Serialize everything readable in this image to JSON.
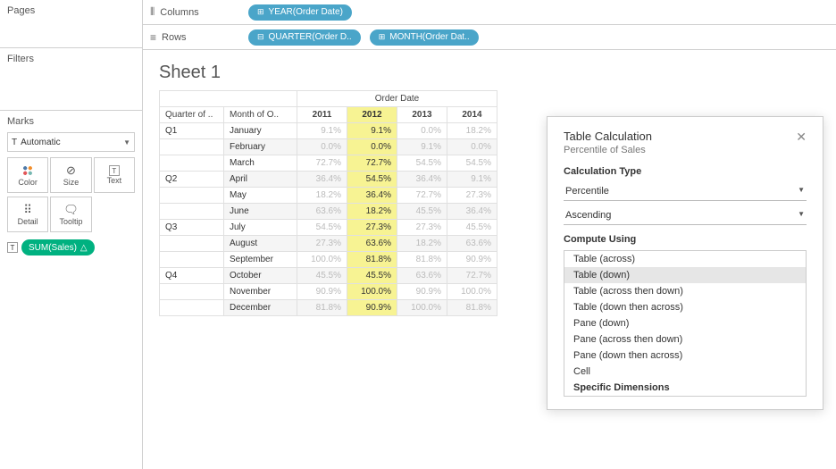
{
  "sidebar": {
    "pages_label": "Pages",
    "filters_label": "Filters",
    "marks_label": "Marks",
    "marks_type": "Automatic",
    "cards": {
      "color": "Color",
      "size": "Size",
      "text": "Text",
      "detail": "Detail",
      "tooltip": "Tooltip"
    },
    "measure_pill": "SUM(Sales)"
  },
  "shelves": {
    "columns_label": "Columns",
    "rows_label": "Rows",
    "columns_pills": [
      "YEAR(Order Date)"
    ],
    "rows_pills": [
      "QUARTER(Order D..",
      "MONTH(Order Dat.."
    ]
  },
  "sheet": {
    "title": "Sheet 1",
    "super_header": "Order Date",
    "corner_q": "Quarter of ..",
    "corner_m": "Month of O..",
    "years": [
      "2011",
      "2012",
      "2013",
      "2014"
    ],
    "rows": [
      {
        "q": "Q1",
        "m": "January",
        "v": [
          "9.1%",
          "9.1%",
          "0.0%",
          "18.2%"
        ]
      },
      {
        "q": "",
        "m": "February",
        "v": [
          "0.0%",
          "0.0%",
          "9.1%",
          "0.0%"
        ],
        "alt": true
      },
      {
        "q": "",
        "m": "March",
        "v": [
          "72.7%",
          "72.7%",
          "54.5%",
          "54.5%"
        ]
      },
      {
        "q": "Q2",
        "m": "April",
        "v": [
          "36.4%",
          "54.5%",
          "36.4%",
          "9.1%"
        ],
        "alt": true
      },
      {
        "q": "",
        "m": "May",
        "v": [
          "18.2%",
          "36.4%",
          "72.7%",
          "27.3%"
        ]
      },
      {
        "q": "",
        "m": "June",
        "v": [
          "63.6%",
          "18.2%",
          "45.5%",
          "36.4%"
        ],
        "alt": true
      },
      {
        "q": "Q3",
        "m": "July",
        "v": [
          "54.5%",
          "27.3%",
          "27.3%",
          "45.5%"
        ]
      },
      {
        "q": "",
        "m": "August",
        "v": [
          "27.3%",
          "63.6%",
          "18.2%",
          "63.6%"
        ],
        "alt": true
      },
      {
        "q": "",
        "m": "September",
        "v": [
          "100.0%",
          "81.8%",
          "81.8%",
          "90.9%"
        ]
      },
      {
        "q": "Q4",
        "m": "October",
        "v": [
          "45.5%",
          "45.5%",
          "63.6%",
          "72.7%"
        ],
        "alt": true
      },
      {
        "q": "",
        "m": "November",
        "v": [
          "90.9%",
          "100.0%",
          "90.9%",
          "100.0%"
        ]
      },
      {
        "q": "",
        "m": "December",
        "v": [
          "81.8%",
          "90.9%",
          "100.0%",
          "81.8%"
        ],
        "alt": true
      }
    ],
    "highlight_col": 1
  },
  "dialog": {
    "title": "Table Calculation",
    "subtitle": "Percentile of Sales",
    "calc_type_label": "Calculation Type",
    "calc_type_value": "Percentile",
    "order_value": "Ascending",
    "compute_label": "Compute Using",
    "options": [
      "Table (across)",
      "Table (down)",
      "Table (across then down)",
      "Table (down then across)",
      "Pane (down)",
      "Pane (across then down)",
      "Pane (down then across)",
      "Cell",
      "Specific Dimensions"
    ],
    "selected_index": 1
  }
}
